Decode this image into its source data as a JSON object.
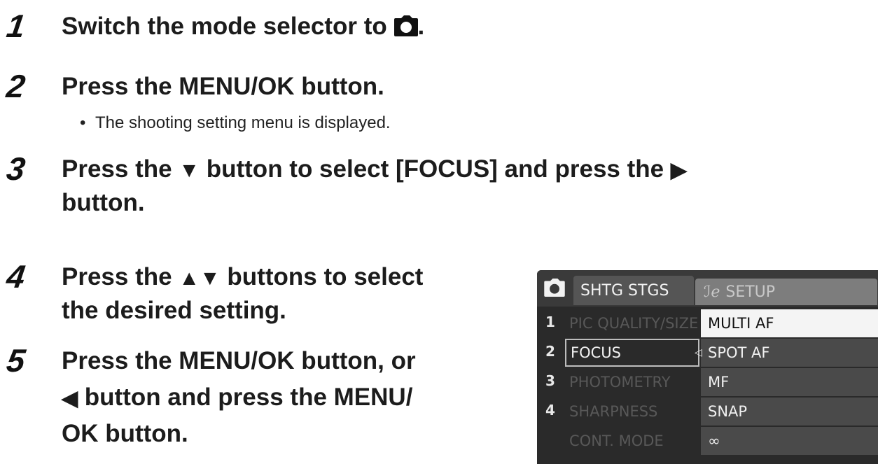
{
  "steps": [
    {
      "number": "1",
      "pre": "Switch the mode selector to ",
      "post": "."
    },
    {
      "number": "2",
      "text": "Press the MENU/OK button.",
      "bullet": "The shooting setting menu is displayed."
    },
    {
      "number": "3",
      "pre": "Press the ",
      "down_glyph": "▼",
      "mid": " button to select [FOCUS] and press the ",
      "right_glyph": "▶",
      "line2": "button."
    },
    {
      "number": "4",
      "pre": "Press the ",
      "updown_glyph": "▲▼",
      "post": " buttons to select",
      "line2": "the desired setting."
    },
    {
      "number": "5",
      "line1": "Press the MENU/OK button, or",
      "left_glyph": "◀",
      "line2": " button and press the MENU/",
      "line3": "OK button."
    }
  ],
  "camera_screen": {
    "tab_active": "SHTG STGS",
    "tab_inactive": "SETUP",
    "menu_numbers": [
      "1",
      "2",
      "3",
      "4"
    ],
    "menu_items": [
      "PIC QUALITY/SIZE",
      "FOCUS",
      "PHOTOMETRY",
      "SHARPNESS",
      "CONT. MODE"
    ],
    "selected_item": "FOCUS",
    "options": [
      "MULTI AF",
      "SPOT AF",
      "MF",
      "SNAP",
      "∞"
    ],
    "selected_option": "MULTI AF",
    "colors": {
      "screen_bg": "#2a2a2a",
      "highlight": "#f4f4f4",
      "option_bg": "#4a4a4a"
    }
  }
}
